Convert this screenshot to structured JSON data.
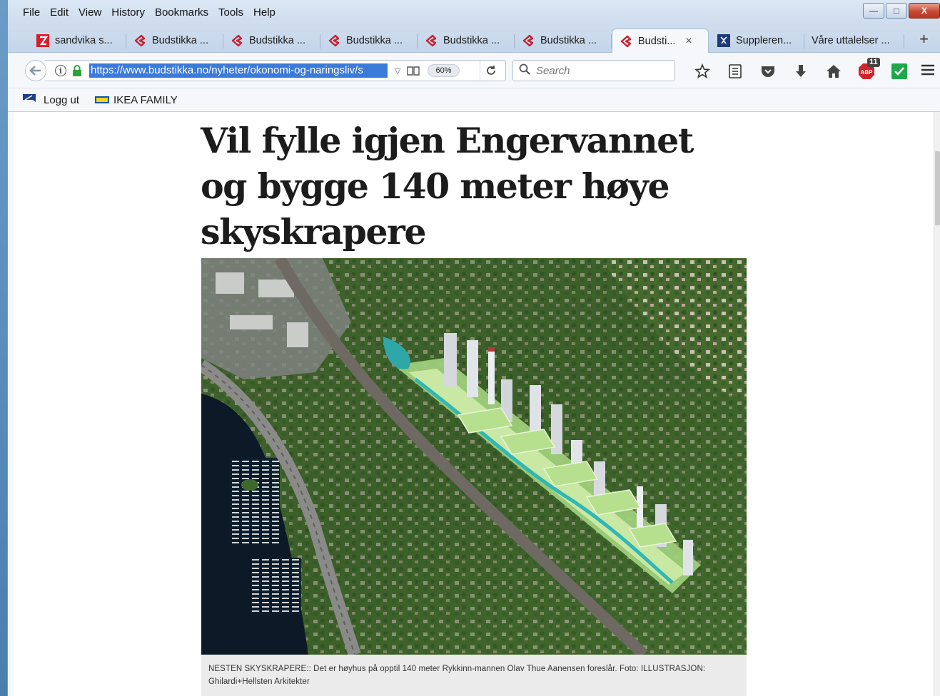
{
  "menu": {
    "items": [
      {
        "label": "File"
      },
      {
        "label": "Edit"
      },
      {
        "label": "View"
      },
      {
        "label": "History"
      },
      {
        "label": "Bookmarks"
      },
      {
        "label": "Tools"
      },
      {
        "label": "Help"
      }
    ]
  },
  "window_controls": {
    "minimize": "—",
    "maximize": "□",
    "close": "X"
  },
  "tabs": [
    {
      "label": "sandvika s...",
      "icon": "red-z-icon"
    },
    {
      "label": "Budstikka ...",
      "icon": "budstikka-icon"
    },
    {
      "label": "Budstikka ...",
      "icon": "budstikka-icon"
    },
    {
      "label": "Budstikka ...",
      "icon": "budstikka-icon"
    },
    {
      "label": "Budstikka ...",
      "icon": "budstikka-icon"
    },
    {
      "label": "Budstikka ...",
      "icon": "budstikka-icon"
    },
    {
      "label": "Budsti...",
      "icon": "budstikka-icon",
      "active": true,
      "close": "×"
    },
    {
      "label": "Suppleren...",
      "icon": "crest-icon"
    },
    {
      "label": "Våre uttalelser ...",
      "icon": ""
    }
  ],
  "new_tab": "+",
  "navbar": {
    "url": "https://www.budstikka.no/nyheter/okonomi-og-naringsliv/s",
    "zoom": "60%",
    "search_placeholder": "Search",
    "abp_count": "11"
  },
  "bookmarks": [
    {
      "label": "Logg ut",
      "icon": "blue-flag-icon"
    },
    {
      "label": "IKEA FAMILY",
      "icon": "ikea-icon"
    }
  ],
  "article": {
    "headline": "Vil fylle igjen Engervannet og bygge 140 meter høye skyskrapere",
    "caption": "NESTEN SKYSKRAPERE:: Det er høyhus på opptil 140 meter Rykkinn-mannen Olav Thue Aanensen foreslår. Foto: ILLUSTRASJON: Ghilardi+Hellsten Arkitekter"
  },
  "colors": {
    "url_highlight": "#3a7ad8",
    "budstikka_red": "#c8202e",
    "abp_red": "#d0232a",
    "check_green": "#1ea84a"
  }
}
